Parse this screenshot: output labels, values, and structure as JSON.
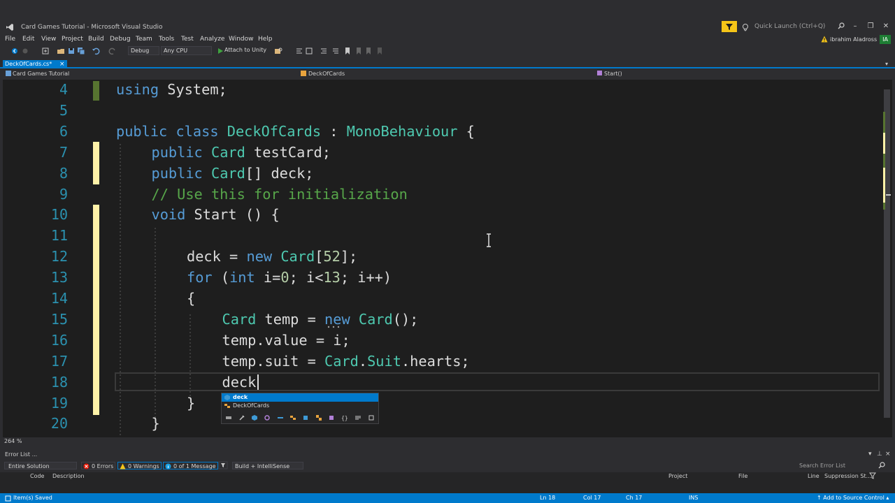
{
  "window": {
    "title": "Card Games Tutorial - Microsoft Visual Studio",
    "quick_launch_placeholder": "Quick Launch (Ctrl+Q)",
    "controls": [
      "–",
      "❐",
      "✕"
    ]
  },
  "menu": [
    "File",
    "Edit",
    "View",
    "Project",
    "Build",
    "Debug",
    "Team",
    "Tools",
    "Test",
    "Analyze",
    "Window",
    "Help"
  ],
  "user": {
    "name": "ibrahim Aladross",
    "initials": "IA"
  },
  "toolbar": {
    "config": "Debug",
    "platform": "Any CPU",
    "attach_label": "Attach to Unity"
  },
  "tabs": [
    {
      "label": "DeckOfCards.cs*",
      "active": true
    }
  ],
  "navbar": {
    "project": "Card Games Tutorial",
    "type": "DeckOfCards",
    "member": "Start()"
  },
  "editor": {
    "line_numbers": [
      "4",
      "5",
      "6",
      "7",
      "8",
      "9",
      "10",
      "11",
      "12",
      "13",
      "14",
      "15",
      "16",
      "17",
      "18",
      "19",
      "20"
    ],
    "lines": [
      [
        [
          "kw",
          "using"
        ],
        [
          "",
          "System;"
        ]
      ],
      [],
      [
        [
          "kw",
          "public class"
        ],
        [
          "",
          ""
        ],
        [
          "ty",
          "DeckOfCards"
        ],
        [
          "",
          " : "
        ],
        [
          "ty",
          "MonoBehaviour"
        ],
        [
          "",
          " {"
        ]
      ],
      [
        [
          "",
          ""
        ],
        [
          "kw",
          "public"
        ],
        [
          "",
          " "
        ],
        [
          "ty",
          "Card"
        ],
        [
          "",
          " testCard;"
        ]
      ],
      [
        [
          "",
          ""
        ],
        [
          "kw",
          "public"
        ],
        [
          "",
          " "
        ],
        [
          "ty",
          "Card"
        ],
        [
          "",
          "[] deck;"
        ]
      ],
      [
        [
          "cm",
          "// Use this for initialization"
        ]
      ],
      [
        [
          "kw",
          "void"
        ],
        [
          "",
          " Start () {"
        ]
      ],
      [],
      [
        [
          "",
          "deck = "
        ],
        [
          "kw",
          "new"
        ],
        [
          "",
          " "
        ],
        [
          "ty",
          "Card"
        ],
        [
          "",
          "["
        ],
        [
          "nm",
          "52"
        ],
        [
          "",
          "];"
        ]
      ],
      [
        [
          "kw",
          "for"
        ],
        [
          "",
          " ("
        ],
        [
          "kw",
          "int"
        ],
        [
          "",
          " i="
        ],
        [
          "nm",
          "0"
        ],
        [
          "",
          "; i<"
        ],
        [
          "nm",
          "13"
        ],
        [
          "",
          "; i++)"
        ]
      ],
      [
        [
          "",
          "{"
        ]
      ],
      [
        [
          "ty",
          "Card"
        ],
        [
          "",
          " temp = "
        ],
        [
          "kw",
          "new"
        ],
        [
          "",
          " "
        ],
        [
          "ty",
          "Card"
        ],
        [
          "",
          "();"
        ]
      ],
      [
        [
          "",
          "temp.value = i;"
        ]
      ],
      [
        [
          "",
          "temp.suit = "
        ],
        [
          "ty",
          "Card"
        ],
        [
          "",
          "."
        ],
        [
          "ty",
          "Suit"
        ],
        [
          "",
          ".hearts;"
        ]
      ],
      [
        [
          "",
          "deck"
        ]
      ],
      [
        [
          "",
          "}"
        ]
      ],
      [
        [
          "",
          "}"
        ]
      ]
    ],
    "zoom": "264 %"
  },
  "intellisense": {
    "items": [
      "deck",
      "DeckOfCards"
    ],
    "selected": 0
  },
  "error_list": {
    "title": "Error List ...",
    "scope": "Entire Solution",
    "errors": "0 Errors",
    "warnings": "0 Warnings",
    "messages": "0 of 1 Message",
    "build_filter": "Build + IntelliSense",
    "search_placeholder": "Search Error List",
    "columns": [
      "Code",
      "Description",
      "Project",
      "File",
      "Line",
      "Suppression St..."
    ]
  },
  "status": {
    "left": "Item(s) Saved",
    "ln": "Ln 18",
    "col": "Col 17",
    "ch": "Ch 17",
    "ins": "INS",
    "source_control": "Add to Source Control"
  },
  "colors": {
    "accent": "#007acc",
    "keyword": "#569cd6",
    "type": "#4ec9b0",
    "number": "#b5cea8",
    "comment": "#57a64a",
    "line_number": "#2b91af",
    "changed_marker": "#fff2a8",
    "saved_marker": "#577430"
  }
}
